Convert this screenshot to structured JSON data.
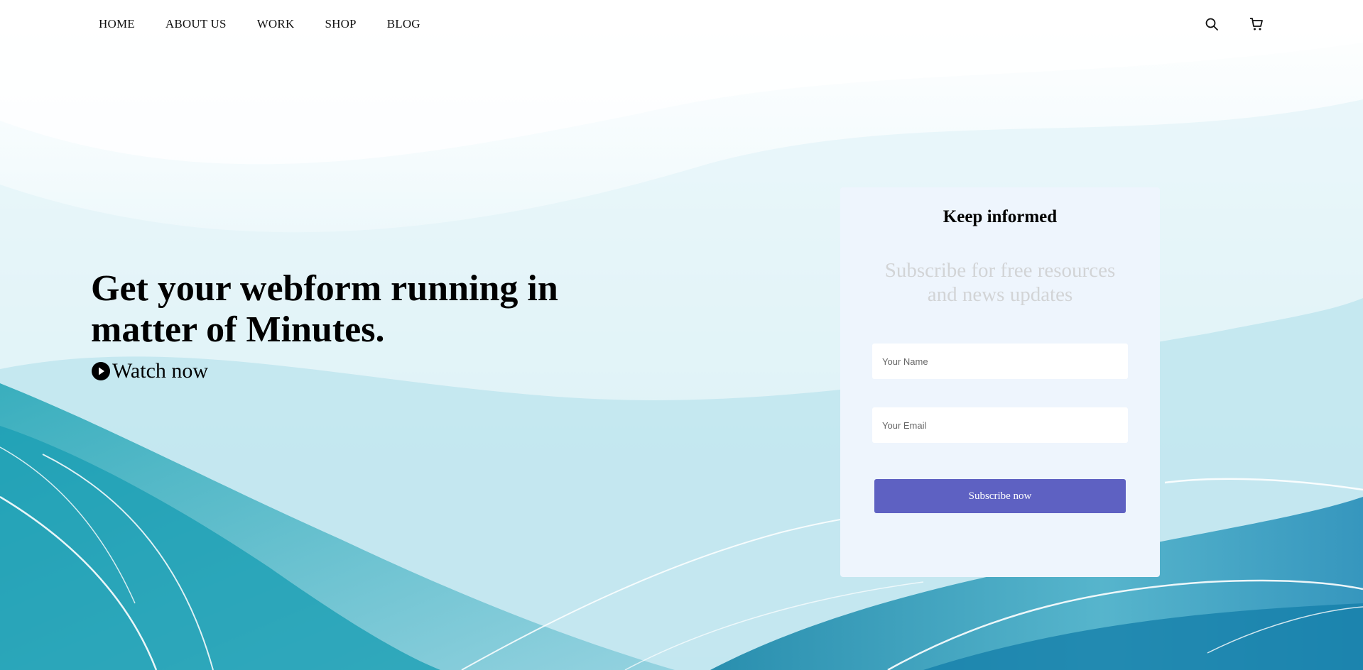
{
  "nav": {
    "items": [
      "HOME",
      "ABOUT US",
      "WORK",
      "SHOP",
      "BLOG"
    ]
  },
  "header_icons": {
    "search": "search-icon",
    "cart": "cart-icon"
  },
  "hero": {
    "headline": "Get your webform running in matter of Minutes.",
    "watch_label": "Watch now",
    "watch_icon": "play-circle-icon"
  },
  "signup": {
    "title": "Keep informed",
    "subtitle": "Subscribe for free resources and news updates",
    "name_placeholder": "Your Name",
    "email_placeholder": "Your Email",
    "button_label": "Subscribe now"
  },
  "colors": {
    "accent": "#5e61c2",
    "card_bg": "#eef5fd",
    "wave_dark": "#1a95b3",
    "wave_light": "#c8ecf2"
  }
}
